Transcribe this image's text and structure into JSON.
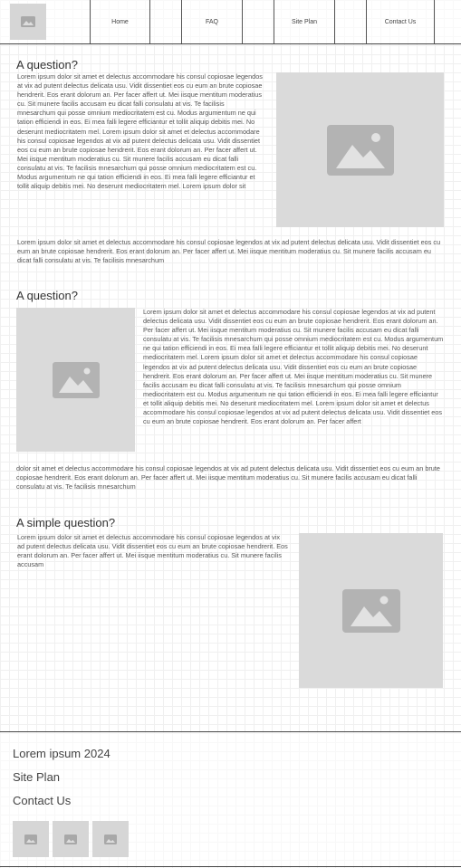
{
  "header": {
    "logo_icon": "image-placeholder-icon",
    "nav": [
      {
        "label": "Home"
      },
      {
        "label": "FAQ"
      },
      {
        "label": "Site Plan"
      },
      {
        "label": "Contact Us"
      }
    ]
  },
  "sections": [
    {
      "title": "A question?",
      "wrap_text": "Lorem ipsum dolor sit amet et delectus accommodare his consul copiosae legendos at vix ad putent delectus delicata usu. Vidit dissentiet eos cu eum an brute copiosae hendrerit. Eos erant dolorum an. Per facer affert ut. Mei iisque mentitum moderatius cu. Sit munere facilis accusam eu dicat falli consulatu at vis. Te facilisis mnesarchum qui posse omnium mediocritatem est cu. Modus argumentum ne qui tation efficiendi in eos. Ei mea falli legere efficiantur et tollit aliquip debitis mei. No deserunt mediocritatem mel. Lorem ipsum dolor sit amet et delectus accommodare his consul copiosae legendos at vix ad putent delectus delicata usu. Vidit dissentiet eos cu eum an brute copiosae hendrerit. Eos erant dolorum an. Per facer affert ut. Mei iisque mentitum moderatius cu. Sit munere facilis accusam eu dicat falli consulatu at vis. Te facilisis mnesarchum qui posse omnium mediocritatem est cu. Modus argumentum ne qui tation efficiendi in eos. Ei mea falli legere efficiantur et tollit aliquip debitis mei. No deserunt mediocritatem mel. Lorem ipsum dolor sit",
      "full_text": "Lorem ipsum dolor sit amet et delectus accommodare his consul copiosae legendos at vix ad putent delectus delicata usu. Vidit dissentiet eos cu eum an brute copiosae hendrerit. Eos erant dolorum an. Per facer affert ut. Mei iisque mentitum moderatius cu. Sit munere facilis accusam eu dicat falli consulatu at vis. Te facilisis mnesarchum",
      "image_icon": "image-placeholder-icon"
    },
    {
      "title": "A question?",
      "wrap_text": "Lorem ipsum dolor sit amet et delectus accommodare his consul copiosae legendos at vix ad putent delectus delicata usu. Vidit dissentiet eos cu eum an brute copiosae hendrerit. Eos erant dolorum an. Per facer affert ut. Mei iisque mentitum moderatius cu. Sit munere facilis accusam eu dicat falli consulatu at vis. Te facilisis mnesarchum qui posse omnium mediocritatem est cu. Modus argumentum ne qui tation efficiendi in eos. Ei mea falli legere efficiantur et tollit aliquip debitis mei. No deserunt mediocritatem mel. Lorem ipsum dolor sit amet et delectus accommodare his consul copiosae legendos at vix ad putent delectus delicata usu. Vidit dissentiet eos cu eum an brute copiosae hendrerit. Eos erant dolorum an. Per facer affert ut. Mei iisque mentitum moderatius cu. Sit munere facilis accusam eu dicat falli consulatu at vis. Te facilisis mnesarchum qui posse omnium mediocritatem est cu. Modus argumentum ne qui tation efficiendi in eos. Ei mea falli legere efficiantur et tollit aliquip debitis mei. No deserunt mediocritatem mel. Lorem ipsum dolor sit amet et delectus accommodare his consul copiosae legendos at vix ad putent delectus delicata usu. Vidit dissentiet eos cu eum an brute copiosae hendrerit. Eos erant dolorum an. Per facer affert",
      "full_text": "dolor sit amet et delectus accommodare his consul copiosae legendos at vix ad putent delectus delicata usu. Vidit dissentiet eos cu eum an brute copiosae hendrerit. Eos erant dolorum an. Per facer affert ut. Mei iisque mentitum moderatius cu. Sit munere facilis accusam eu dicat falli consulatu at vis. Te facilisis mnesarchum",
      "image_icon": "image-placeholder-icon"
    },
    {
      "title": "A simple question?",
      "wrap_text": "Lorem ipsum dolor sit amet et delectus accommodare his consul copiosae legendos at vix ad putent delectus delicata usu. Vidit dissentiet eos cu eum an brute copiosae hendrerit. Eos erant dolorum an. Per facer affert ut. Mei iisque mentitum moderatius cu. Sit munere facilis accusam",
      "image_icon": "image-placeholder-icon"
    }
  ],
  "footer": {
    "copyright": "Lorem ipsum 2024",
    "site_plan": "Site Plan",
    "contact": "Contact Us",
    "icons": [
      "image-placeholder-icon",
      "image-placeholder-icon",
      "image-placeholder-icon"
    ]
  }
}
